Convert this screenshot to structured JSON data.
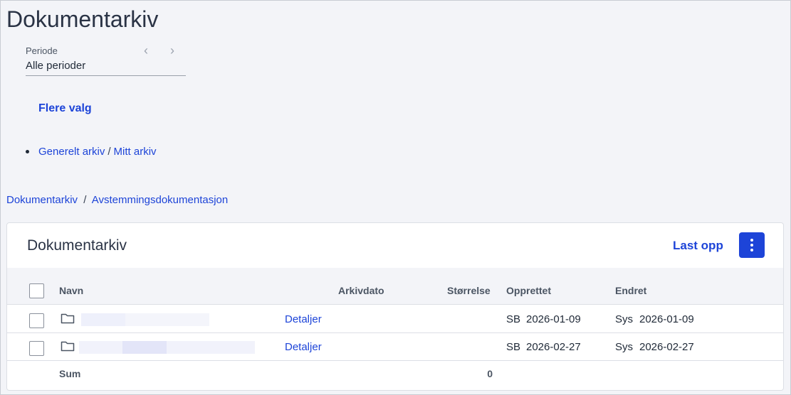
{
  "page": {
    "title": "Dokumentarkiv"
  },
  "period": {
    "label": "Periode",
    "value": "Alle perioder"
  },
  "more_options": "Flere valg",
  "archive_path": {
    "part1": "Generelt arkiv",
    "separator": "/",
    "part2": "Mitt arkiv"
  },
  "breadcrumb": {
    "root": "Dokumentarkiv",
    "separator": "/",
    "current": "Avstemmingsdokumentasjon"
  },
  "card": {
    "title": "Dokumentarkiv",
    "upload_label": "Last opp",
    "menu_icon": "kebab-vertical-icon"
  },
  "table": {
    "columns": [
      "Navn",
      "Arkivdato",
      "Størrelse",
      "Opprettet",
      "Endret"
    ],
    "rows": [
      {
        "icon": "folder-icon",
        "name": "",
        "link": "Detaljer",
        "archive_date": "",
        "size": "",
        "created_by": "SB",
        "created": "2026-01-09",
        "changed_by": "Sys",
        "changed": "2026-01-09"
      },
      {
        "icon": "folder-icon",
        "name": "",
        "link": "Detaljer",
        "archive_date": "",
        "size": "",
        "created_by": "SB",
        "created": "2026-02-27",
        "changed_by": "Sys",
        "changed": "2026-02-27"
      }
    ],
    "sum_label": "Sum",
    "sum_value": "0"
  },
  "colors": {
    "accent": "#1d44d8",
    "background": "#f3f4f8",
    "card": "#ffffff"
  }
}
